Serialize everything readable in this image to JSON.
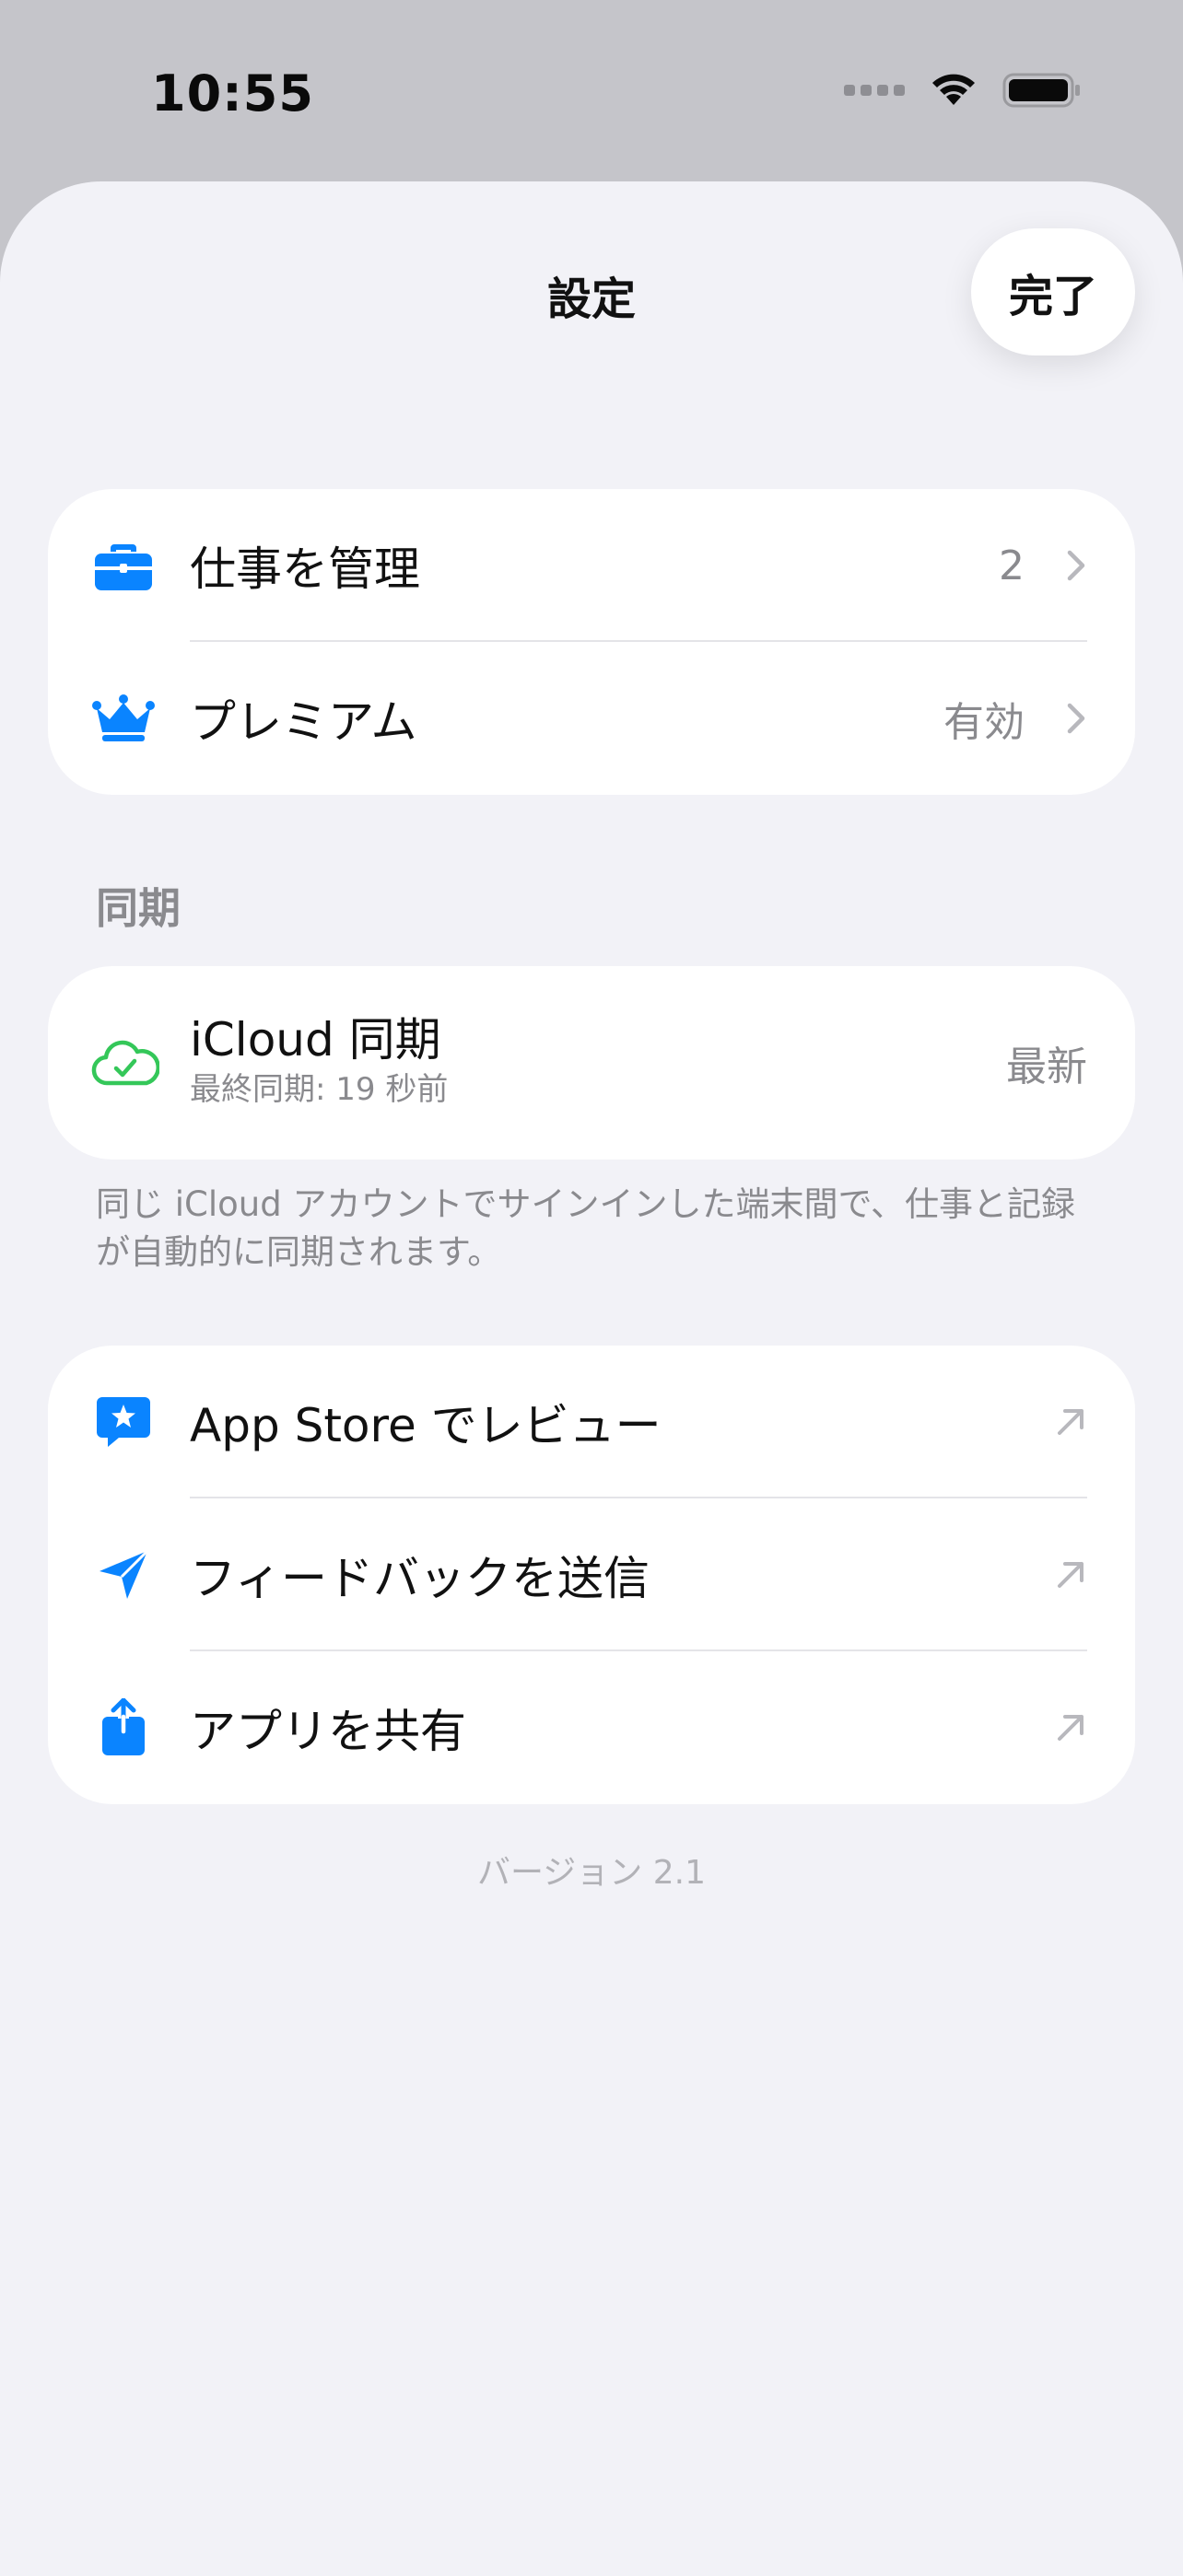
{
  "status_bar": {
    "time": "10:55"
  },
  "header": {
    "title": "設定",
    "done_label": "完了"
  },
  "main_group": {
    "items": [
      {
        "label": "仕事を管理",
        "value": "2",
        "icon": "briefcase-icon"
      },
      {
        "label": "プレミアム",
        "value": "有効",
        "icon": "crown-icon"
      }
    ]
  },
  "sync_section": {
    "header": "同期",
    "title": "iCloud 同期",
    "subtitle": "最終同期: 19 秒前",
    "status": "最新",
    "icon": "cloud-check-icon",
    "footer": "同じ iCloud アカウントでサインインした端末間で、仕事と記録が自動的に同期されます。"
  },
  "links_group": {
    "items": [
      {
        "label": "App Store でレビュー",
        "icon": "star-bubble-icon"
      },
      {
        "label": "フィードバックを送信",
        "icon": "paper-plane-icon"
      },
      {
        "label": "アプリを共有",
        "icon": "share-icon"
      }
    ]
  },
  "version": "バージョン 2.1",
  "colors": {
    "accent": "#0a84ff",
    "sync_green": "#34c759",
    "background": "#f2f2f7",
    "secondary_text": "#8a8a8e"
  }
}
